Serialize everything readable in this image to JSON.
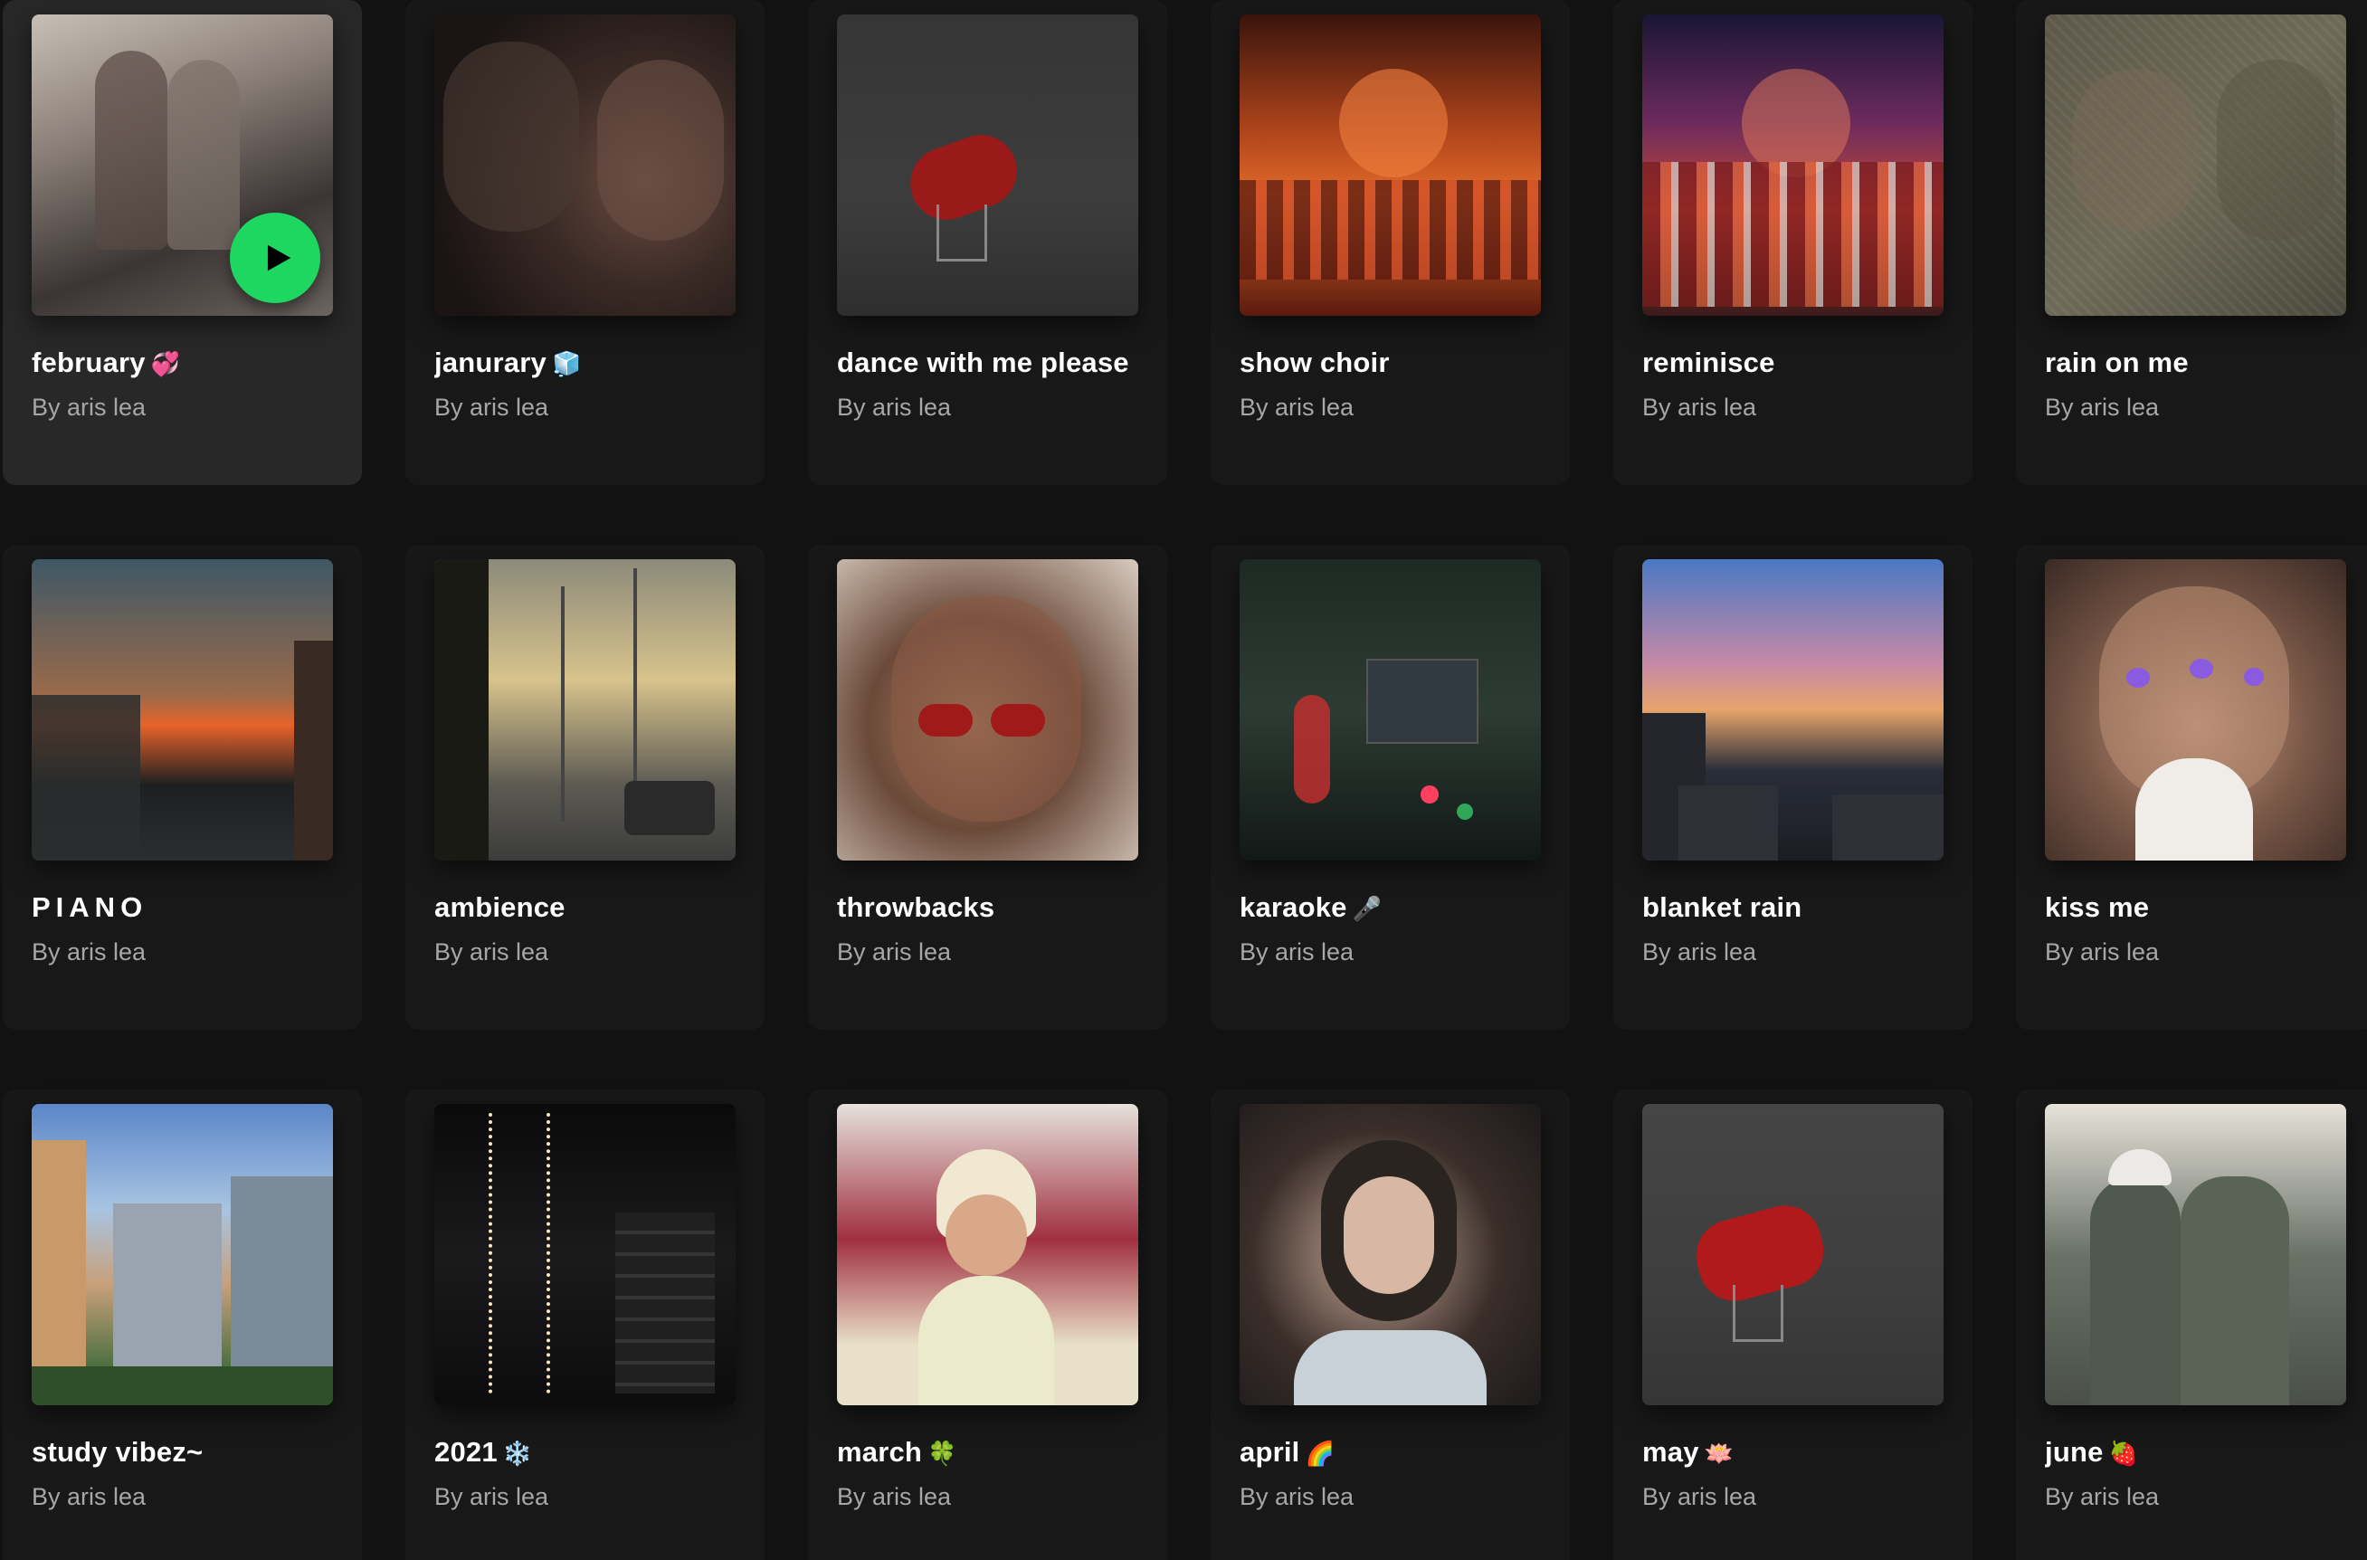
{
  "playlists": [
    {
      "title": "february",
      "emoji": "💞",
      "subtitle": "By aris lea",
      "active": true
    },
    {
      "title": "janurary",
      "emoji": "🧊",
      "subtitle": "By aris lea"
    },
    {
      "title": "dance with me please",
      "emoji": "",
      "subtitle": "By aris lea"
    },
    {
      "title": "show choir",
      "emoji": "",
      "subtitle": "By aris lea"
    },
    {
      "title": "reminisce",
      "emoji": "",
      "subtitle": "By aris lea"
    },
    {
      "title": "rain on me",
      "emoji": "",
      "subtitle": "By aris lea"
    },
    {
      "title": "PIANO",
      "emoji": "",
      "subtitle": "By aris lea"
    },
    {
      "title": "ambience",
      "emoji": "",
      "subtitle": "By aris lea"
    },
    {
      "title": "throwbacks",
      "emoji": "",
      "subtitle": "By aris lea"
    },
    {
      "title": "karaoke",
      "emoji": "🎤",
      "subtitle": "By aris lea"
    },
    {
      "title": "blanket rain",
      "emoji": "",
      "subtitle": "By aris lea"
    },
    {
      "title": "kiss me",
      "emoji": "",
      "subtitle": "By aris lea"
    },
    {
      "title": "study vibez~",
      "emoji": "",
      "subtitle": "By aris lea"
    },
    {
      "title": "2021",
      "emoji": "❄️",
      "subtitle": "By aris lea"
    },
    {
      "title": "march",
      "emoji": "🍀",
      "subtitle": "By aris lea"
    },
    {
      "title": "april",
      "emoji": "🌈",
      "subtitle": "By aris lea"
    },
    {
      "title": "may",
      "emoji": "🪷",
      "subtitle": "By aris lea"
    },
    {
      "title": "june",
      "emoji": "🍓",
      "subtitle": "By aris lea"
    }
  ],
  "colors": {
    "background": "#121212",
    "card": "#181818",
    "card_active": "#282828",
    "play_button": "#1ed760"
  },
  "icons": {
    "play_button": "play-icon"
  }
}
